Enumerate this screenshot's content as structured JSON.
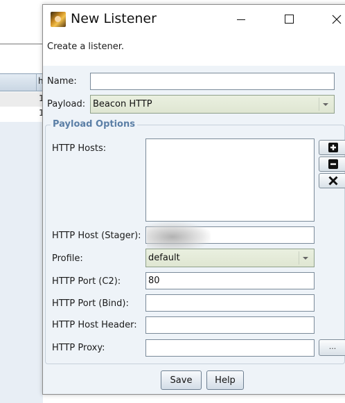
{
  "background": {
    "header_label": "h",
    "rows": [
      "1",
      "1"
    ]
  },
  "window": {
    "title": "New Listener",
    "icon": "app-icon",
    "controls": [
      "minimize-icon",
      "maximize-icon",
      "close-icon"
    ]
  },
  "description": "Create a listener.",
  "form": {
    "name_label": "Name:",
    "name_value": "",
    "payload_label": "Payload:",
    "payload_value": "Beacon HTTP"
  },
  "payload_options": {
    "title": "Payload Options",
    "http_hosts_label": "HTTP Hosts:",
    "http_hosts": [],
    "host_buttons": [
      "plus-icon",
      "minus-icon",
      "x-icon"
    ],
    "stager_label": "HTTP Host (Stager):",
    "stager_value": "",
    "profile_label": "Profile:",
    "profile_value": "default",
    "port_c2_label": "HTTP Port (C2):",
    "port_c2_value": "80",
    "port_bind_label": "HTTP Port (Bind):",
    "port_bind_value": "",
    "host_header_label": "HTTP Host Header:",
    "host_header_value": "",
    "proxy_label": "HTTP Proxy:",
    "proxy_value": "",
    "proxy_button_label": "..."
  },
  "buttons": {
    "save": "Save",
    "help": "Help"
  },
  "colors": {
    "section_title": "#5b7fa6",
    "panel_background": "#eef3f8",
    "combo_background": "#dfe6d2"
  }
}
